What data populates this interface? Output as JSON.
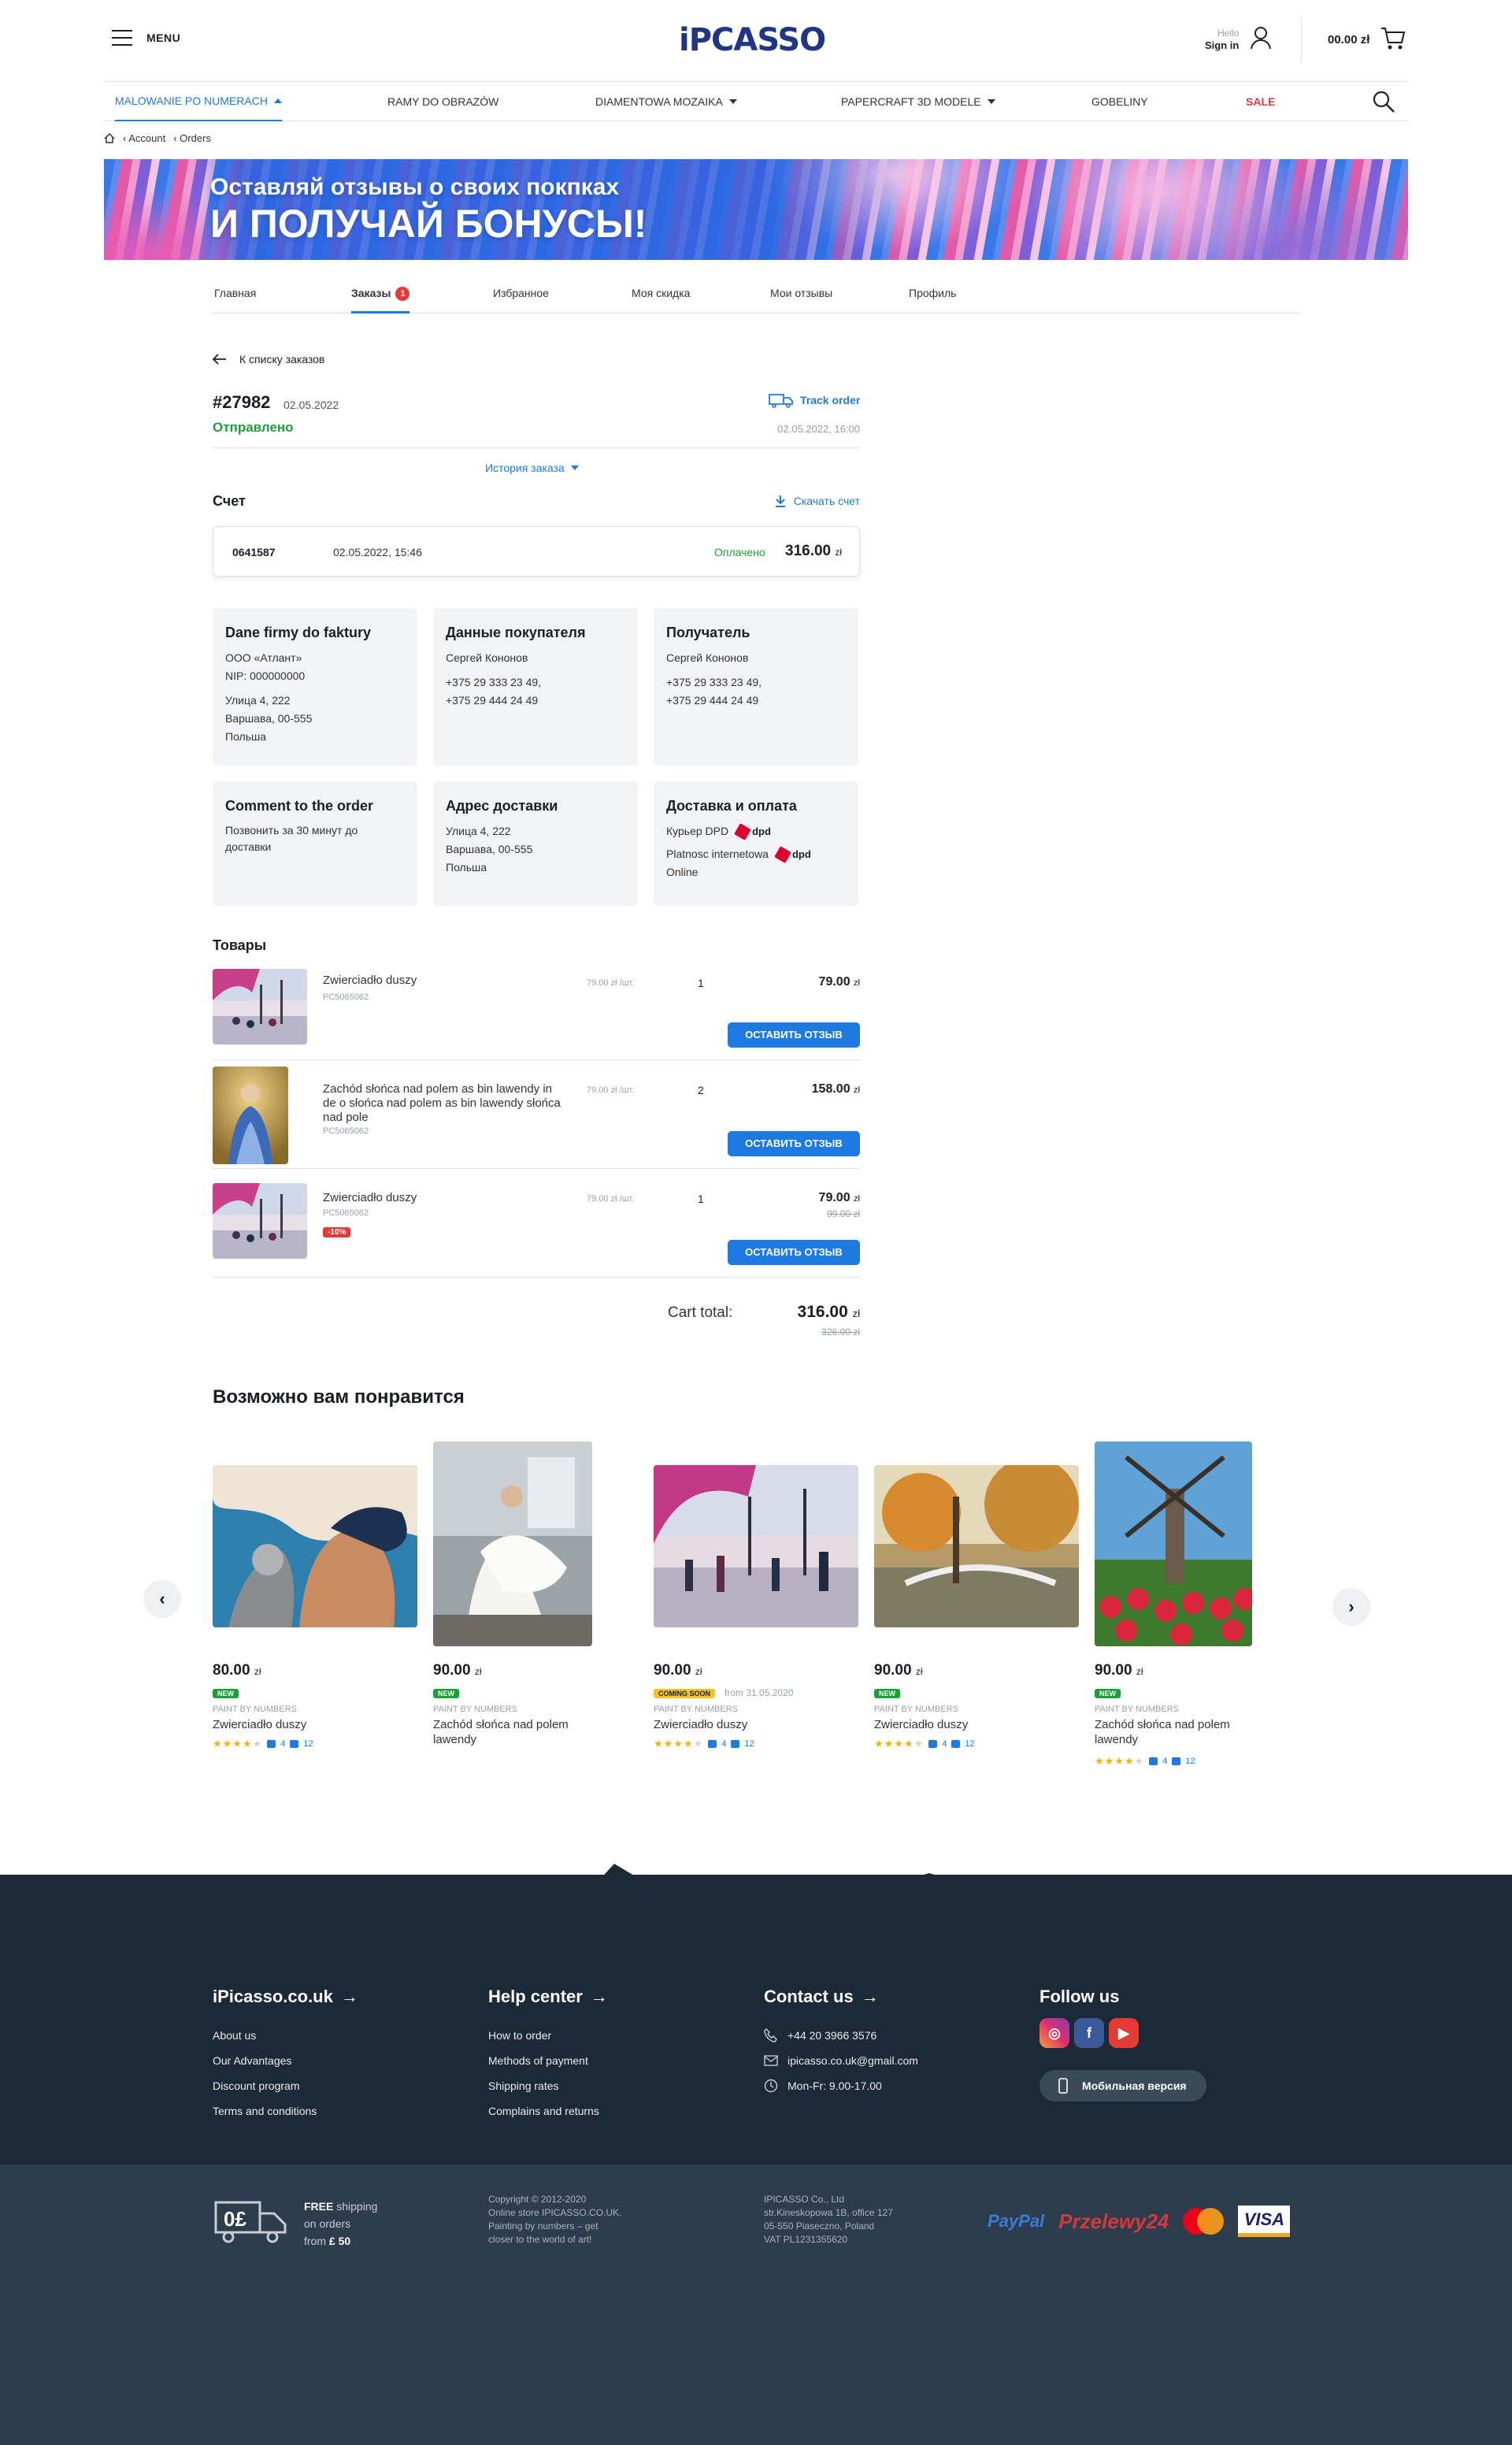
{
  "header": {
    "menu_label": "MENU",
    "logo_prefix": "iP",
    "logo_dot": "i",
    "logo_suffix": "CASSO",
    "hello": "Hello",
    "sign_in": "Sign in",
    "cart_total": "00.00 zł"
  },
  "nav": {
    "items": [
      {
        "label": "MALOWANIE PO NUMERACH"
      },
      {
        "label": "RAMY DO OBRAZÓW"
      },
      {
        "label": "DIAMENTOWA MOZAIKA"
      },
      {
        "label": "PAPERCRAFT 3D MODELE"
      },
      {
        "label": "GOBELINY"
      },
      {
        "label": "SALE"
      }
    ]
  },
  "breadcrumbs": {
    "account": "Account",
    "orders": "Orders"
  },
  "banner": {
    "line1": "Оставляй отзывы о своих покпках",
    "line2": "И ПОЛУЧАЙ БОНУСЫ!"
  },
  "tabs": {
    "home": "Главная",
    "orders": "Заказы",
    "orders_count": "1",
    "favorites": "Избранное",
    "discount": "Моя скидка",
    "reviews": "Мои отзывы",
    "profile": "Профиль"
  },
  "order": {
    "back_label": "К списку заказов",
    "number": "#27982",
    "date": "02.05.2022",
    "status": "Отправлено",
    "track_label": "Track order",
    "updated": "02.05.2022, 16:00",
    "history_label": "История заказа"
  },
  "invoice": {
    "title": "Счет",
    "download_label": "Скачать счет",
    "number": "0641587",
    "datetime": "02.05.2022, 15:46",
    "status": "Оплачено",
    "amount": "316.00",
    "currency": "zł"
  },
  "cards": {
    "company": {
      "title": "Dane firmy do faktury",
      "name": "ООО «Атлант»",
      "nip": "NIP: 000000000",
      "street": "Улица 4, 222",
      "city": "Варшава, 00-555",
      "country": "Польша"
    },
    "buyer": {
      "title": "Данные покупателя",
      "name": "Сергей Кононов",
      "phone1": "+375 29 333 23 49,",
      "phone2": "+375 29 444 24 49"
    },
    "recipient": {
      "title": "Получатель",
      "name": "Сергей Кононов",
      "phone1": "+375 29 333 23 49,",
      "phone2": "+375 29 444 24 49"
    },
    "comment": {
      "title": "Comment to the order",
      "text": "Позвонить за 30 минут до доставки"
    },
    "address": {
      "title": "Адрес доставки",
      "street": "Улица 4, 222",
      "city": "Варшава, 00-555",
      "country": "Польша"
    },
    "delivery": {
      "title": "Доставка и оплата",
      "courier": "Курьер DPD",
      "payment_line1": "Platnosc internetowa",
      "payment_line2": "Online",
      "dpd": "dpd"
    }
  },
  "products": {
    "title": "Товары",
    "review_label": "Оставить отзыв",
    "items": [
      {
        "name": "Zwierciadło duszy",
        "sku": "PC5065062",
        "unit_price": "79.00 zł /шт.",
        "qty": "1",
        "total": "79.00",
        "currency": "zł",
        "old_total": "",
        "discount": ""
      },
      {
        "name": "Zachód słońca nad polem as bin lawendy in de o słońca nad polem as bin lawendy słońca nad pole",
        "sku": "PC5065062",
        "unit_price": "79.00 zł /шт.",
        "qty": "2",
        "total": "158.00",
        "currency": "zł",
        "old_total": "",
        "discount": ""
      },
      {
        "name": "Zwierciadło duszy",
        "sku": "PC5065062",
        "unit_price": "79.00 zł /шт.",
        "qty": "1",
        "total": "79.00",
        "currency": "zł",
        "old_total": "99.00 zł",
        "discount": "-10%"
      }
    ]
  },
  "cart_total": {
    "label": "Cart total:",
    "value": "316.00",
    "currency": "zł",
    "old": "326.00 zł"
  },
  "recommended": {
    "title": "Возможно вам понравится",
    "prev": "‹",
    "next": "›",
    "items": [
      {
        "price": "80.00",
        "currency": "zł",
        "badge": "NEW",
        "badge_type": "new",
        "category": "PAINT BY NUMBERS",
        "name": "Zwierciadło duszy",
        "rating": 4,
        "comments": "4",
        "photos": "12",
        "soon_date": ""
      },
      {
        "price": "90.00",
        "currency": "zł",
        "badge": "NEW",
        "badge_type": "new",
        "category": "PAINT BY NUMBERS",
        "name": "Zachód słońca nad polem lawendy",
        "rating": 0,
        "comments": "",
        "photos": "",
        "soon_date": ""
      },
      {
        "price": "90.00",
        "currency": "zł",
        "badge": "COMING SOON",
        "badge_type": "soon",
        "category": "PAINT BY NUMBERS",
        "name": "Zwierciadło duszy",
        "rating": 4,
        "comments": "4",
        "photos": "12",
        "soon_date": "from 31.05.2020"
      },
      {
        "price": "90.00",
        "currency": "zł",
        "badge": "NEW",
        "badge_type": "new",
        "category": "PAINT BY NUMBERS",
        "name": "Zwierciadło duszy",
        "rating": 4,
        "comments": "4",
        "photos": "12",
        "soon_date": ""
      },
      {
        "price": "90.00",
        "currency": "zł",
        "badge": "NEW",
        "badge_type": "new",
        "category": "PAINT BY NUMBERS",
        "name": "Zachód słońca nad polem lawendy",
        "rating": 4,
        "comments": "4",
        "photos": "12",
        "soon_date": ""
      }
    ]
  },
  "footer": {
    "col1": {
      "title": "iPicasso.co.uk",
      "links": [
        "About us",
        "Our Advantages",
        "Discount program",
        "Terms and conditions"
      ]
    },
    "col2": {
      "title": "Help center",
      "links": [
        "How to order",
        "Methods of payment",
        "Shipping rates",
        "Complains and returns"
      ]
    },
    "col3": {
      "title": "Contact us",
      "phone": "+44 20 3966 3576",
      "email": "ipicasso.co.uk@gmail.com",
      "hours": "Mon-Fr: 9.00-17.00"
    },
    "col4": {
      "title": "Follow us",
      "mobile_label": "Мобильная версия"
    },
    "shipping": {
      "free": "FREE",
      "line1": "shipping",
      "line2": "on orders",
      "line3": "from",
      "amount": "£ 50",
      "icon_text": "0£"
    },
    "copyright": [
      "Copyright © 2012-2020",
      "Online store IPICASSO.CO.UK.",
      "Painting by numbers – get",
      "closer to the world of art!"
    ],
    "company": [
      "IPICASSO Co., Ltd",
      "str.Kineskopowa 1B, office 127",
      "05-550 Piaseczno, Poland",
      "VAT PL1231355620"
    ],
    "payments": {
      "paypal": "PayPal",
      "przelewy": "Przelewy24",
      "mastercard": "mastercard",
      "visa": "VISA"
    }
  }
}
